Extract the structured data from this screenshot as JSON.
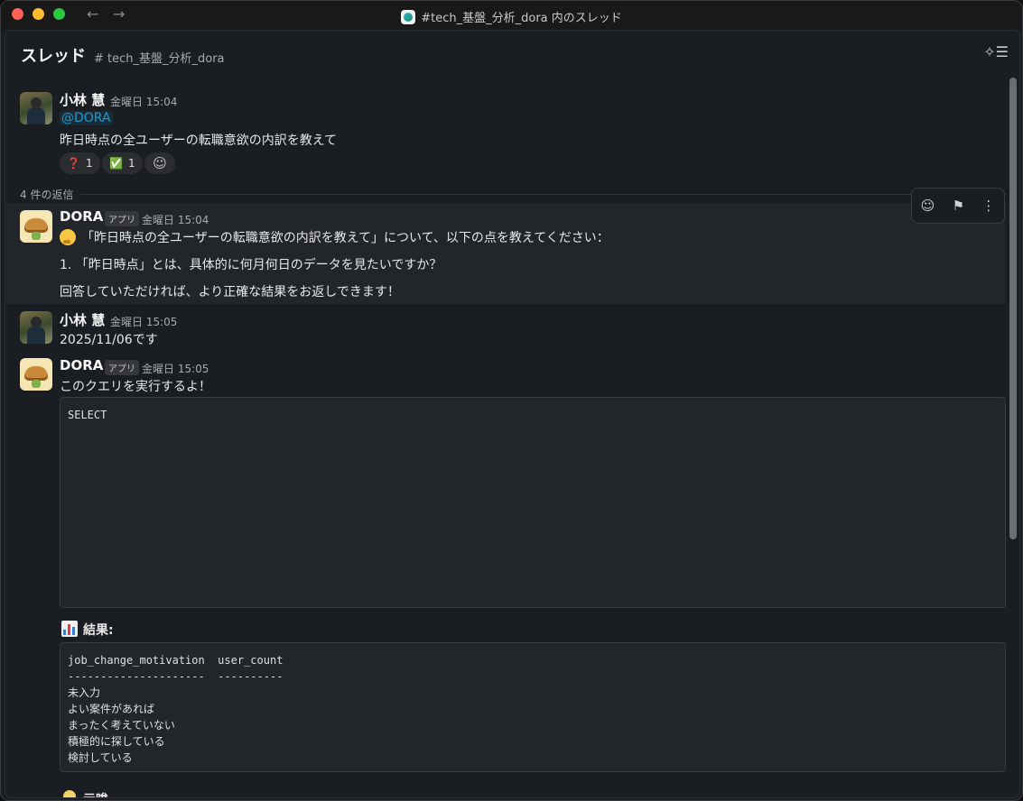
{
  "window": {
    "title": "#tech_基盤_分析_dora 内のスレッド"
  },
  "header": {
    "title": "スレッド",
    "channel": "# tech_基盤_分析_dora"
  },
  "parent": {
    "author": "小林 慧",
    "time": "金曜日 15:04",
    "mention": "@DORA",
    "text": "昨日時点の全ユーザーの転職意欲の内訳を教えて",
    "reactions": [
      {
        "emoji": "❓",
        "count": "1"
      },
      {
        "emoji": "✅",
        "count": "1"
      }
    ]
  },
  "replies_label": "4 件の返信",
  "messages": [
    {
      "author": "DORA",
      "tag": "アプリ",
      "time": "金曜日 15:04",
      "line1": "「昨日時点の全ユーザーの転職意欲の内訳を教えて」について、以下の点を教えてください：",
      "line2": "1. 「昨日時点」とは、具体的に何月何日のデータを見たいですか？",
      "line3": "回答していただければ、より正確な結果をお返しできます！"
    },
    {
      "author": "小林 慧",
      "time": "金曜日 15:05",
      "text": "2025/11/06です"
    },
    {
      "author": "DORA",
      "tag": "アプリ",
      "time": "金曜日 15:05",
      "text": "このクエリを実行するよ！",
      "query": "SELECT",
      "result_label": "結果:",
      "result_table": "job_change_motivation  user_count\n---------------------  ----------\n未入力\nよい案件があれば\nまったく考えていない\n積極的に探している\n検討している",
      "next_label": "示唆"
    }
  ],
  "colors": {
    "accent": "#1d9bd1",
    "background": "#1a1d21",
    "hover": "#222529"
  }
}
